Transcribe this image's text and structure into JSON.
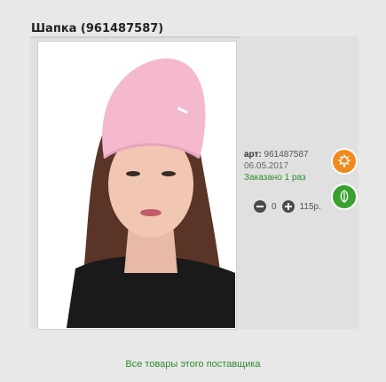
{
  "product": {
    "title": "Шапка (961487587)",
    "article_label": "арт:",
    "article_number": "961487587",
    "date": "06.05.2017",
    "ordered_text": "Заказано 1 раз",
    "quantity": "0",
    "price": "115р."
  },
  "footer": {
    "all_supplier_products": "Все товары этого поставщика"
  },
  "icons": {
    "orange_badge": "maple-leaf-icon",
    "green_badge": "leaf-icon",
    "minus": "minus-circle-icon",
    "plus": "plus-circle-icon"
  },
  "colors": {
    "ordered_text": "#2e8b2e",
    "orange_badge": "#f08a1c",
    "green_badge": "#3aa12f",
    "hat": "#f4b8cf"
  }
}
